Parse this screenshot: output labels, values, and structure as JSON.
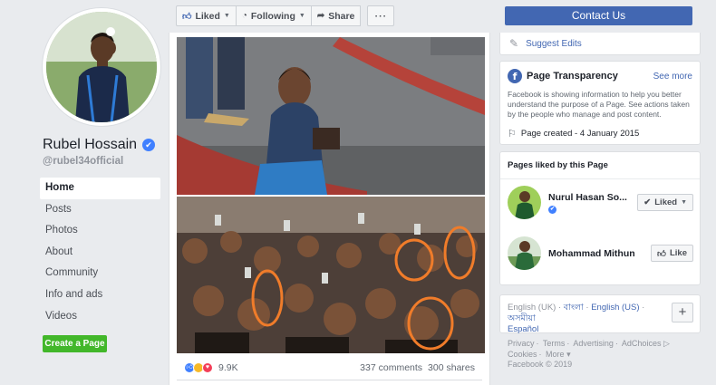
{
  "profile": {
    "name": "Rubel Hossain",
    "handle": "@rubel34official"
  },
  "nav": {
    "items": [
      {
        "label": "Home",
        "active": true
      },
      {
        "label": "Posts"
      },
      {
        "label": "Photos"
      },
      {
        "label": "About"
      },
      {
        "label": "Community"
      },
      {
        "label": "Info and ads"
      },
      {
        "label": "Videos"
      }
    ],
    "create_page": "Create a Page"
  },
  "actions": {
    "liked": "Liked",
    "following": "Following",
    "share": "Share",
    "more": "···"
  },
  "post": {
    "reaction_count": "9.9K",
    "comments": "337 comments",
    "shares": "300 shares"
  },
  "right": {
    "contact": "Contact Us",
    "suggest_edits": "Suggest Edits",
    "transparency": {
      "title": "Page Transparency",
      "see_more": "See more",
      "text": "Facebook is showing information to help you better understand the purpose of a Page. See actions taken by the people who manage and post content.",
      "created": "Page created - 4 January 2015"
    },
    "liked_pages": {
      "title": "Pages liked by this Page",
      "items": [
        {
          "name": "Nurul Hasan So...",
          "button": "Liked",
          "verified": true
        },
        {
          "name": "Mohammad Mithun",
          "button": "Like"
        }
      ]
    },
    "languages": {
      "current": "English (UK)",
      "links": [
        "বাংলা",
        "English (US)",
        "অসমীয়া",
        "Español"
      ],
      "plus": "+"
    },
    "footer": {
      "links": [
        "Privacy",
        "Terms",
        "Advertising",
        "AdChoices",
        "Cookies",
        "More"
      ],
      "copyright": "Facebook © 2019"
    }
  },
  "colors": {
    "brand_blue": "#4267b2",
    "create_green": "#42b72a",
    "verified_blue": "#4080ff",
    "background": "#e9ebee"
  }
}
